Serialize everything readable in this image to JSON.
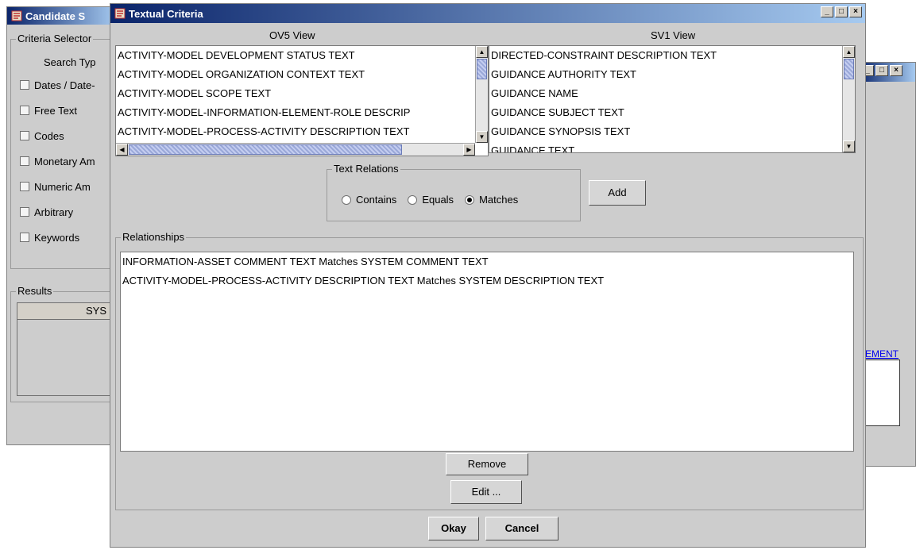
{
  "back_window": {
    "title": "Candidate S",
    "criteria_group_title": "Criteria Selector",
    "search_type_label": "Search Typ",
    "checkboxes": [
      "Dates / Date-",
      "Free Text",
      "Codes",
      "Monetary Am",
      "Numeric Am",
      "Arbitrary",
      "Keywords"
    ],
    "results_group_title": "Results",
    "results_column_header": "SYS"
  },
  "right_window": {
    "link_text": "EMENT"
  },
  "dialog": {
    "title": "Textual Criteria",
    "ov5_label": "OV5 View",
    "sv1_label": "SV1 View",
    "ov5_items": [
      "ACTIVITY-MODEL DEVELOPMENT STATUS TEXT",
      "ACTIVITY-MODEL ORGANIZATION CONTEXT TEXT",
      "ACTIVITY-MODEL SCOPE TEXT",
      "ACTIVITY-MODEL-INFORMATION-ELEMENT-ROLE DESCRIP",
      "ACTIVITY-MODEL-PROCESS-ACTIVITY DESCRIPTION TEXT"
    ],
    "sv1_items": [
      "DIRECTED-CONSTRAINT DESCRIPTION TEXT",
      "GUIDANCE AUTHORITY TEXT",
      "GUIDANCE NAME",
      "GUIDANCE SUBJECT TEXT",
      "GUIDANCE SYNOPSIS TEXT",
      "GUIDANCE TEXT"
    ],
    "text_relations_title": "Text Relations",
    "radios": [
      {
        "label": "Contains",
        "selected": false
      },
      {
        "label": "Equals",
        "selected": false
      },
      {
        "label": "Matches",
        "selected": true
      }
    ],
    "add_label": "Add",
    "relationships_title": "Relationships",
    "relationships": [
      "INFORMATION-ASSET COMMENT TEXT Matches SYSTEM COMMENT TEXT",
      "ACTIVITY-MODEL-PROCESS-ACTIVITY DESCRIPTION TEXT Matches SYSTEM DESCRIPTION TEXT"
    ],
    "remove_label": "Remove",
    "edit_label": "Edit ...",
    "okay_label": "Okay",
    "cancel_label": "Cancel"
  },
  "window_controls": {
    "minimize": "_",
    "maximize": "□",
    "close": "×"
  },
  "colors": {
    "title_start": "#0a246a",
    "title_end": "#a6caf0",
    "window_bg": "#cdcdcd",
    "link": "#0000ee"
  }
}
